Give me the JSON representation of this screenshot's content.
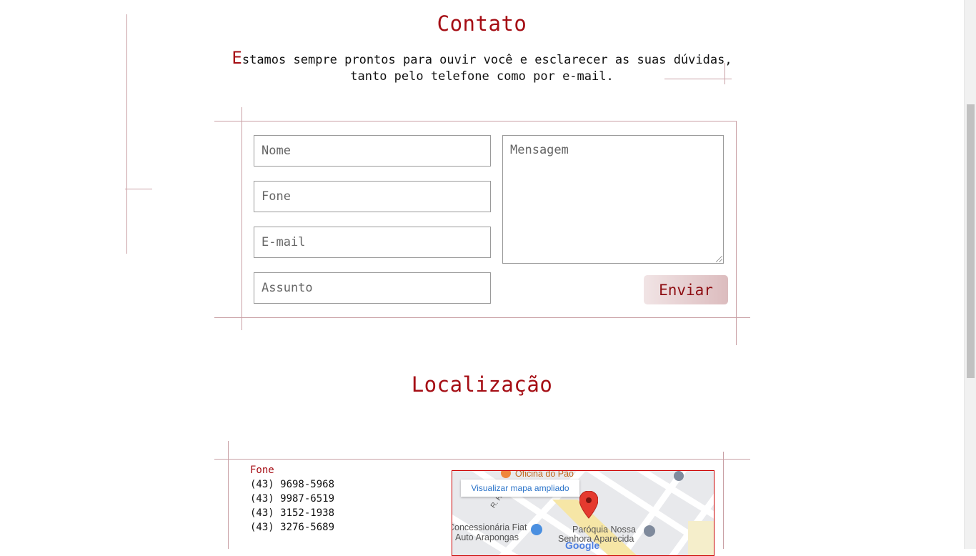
{
  "contact": {
    "title": "Contato",
    "intro_cap": "E",
    "intro_line1_rest": "stamos sempre prontos para ouvir você e esclarecer as suas dúvidas,",
    "intro_line2": "tanto pelo telefone como por e-mail."
  },
  "form": {
    "name_placeholder": "Nome",
    "phone_placeholder": "Fone",
    "email_placeholder": "E-mail",
    "subject_placeholder": "Assunto",
    "message_placeholder": "Mensagem",
    "submit_label": "Enviar"
  },
  "location": {
    "title": "Localização",
    "phone_label": "Fone",
    "phones": [
      "(43) 9698-5968",
      "(43) 9987-6519",
      "(43) 3152-1938",
      "(43) 3276-5689"
    ]
  },
  "map": {
    "enlarge_label": "Visualizar mapa ampliado",
    "places": [
      "Oficina do Pão",
      "Concessionária Fiat",
      "Auto Arapongas",
      "Paróquia Nossa",
      "Senhora Aparecida",
      "R. Harp"
    ],
    "brand": "Google"
  },
  "colors": {
    "accent": "#a50d14",
    "guide_lines": "#c9a0a5",
    "map_border": "#cc0000"
  }
}
